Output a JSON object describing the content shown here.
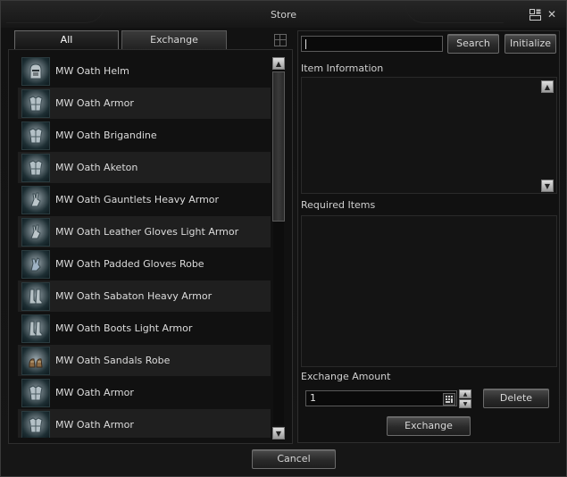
{
  "window": {
    "title": "Store"
  },
  "tabs": [
    {
      "label": "All",
      "active": true
    },
    {
      "label": "Exchange",
      "active": false
    }
  ],
  "items": [
    {
      "name": "MW Oath Helm",
      "icon": "helm-icon"
    },
    {
      "name": "MW Oath Armor",
      "icon": "armor-icon"
    },
    {
      "name": "MW Oath Brigandine",
      "icon": "armor-icon"
    },
    {
      "name": "MW Oath Aketon",
      "icon": "armor-icon"
    },
    {
      "name": "MW Oath Gauntlets Heavy Armor",
      "icon": "gauntlet-icon"
    },
    {
      "name": "MW Oath Leather Gloves Light Armor",
      "icon": "gauntlet-icon"
    },
    {
      "name": "MW Oath Padded Gloves Robe",
      "icon": "glove-icon"
    },
    {
      "name": "MW Oath Sabaton Heavy Armor",
      "icon": "boots-icon"
    },
    {
      "name": "MW Oath Boots Light Armor",
      "icon": "boots-icon"
    },
    {
      "name": "MW Oath Sandals Robe",
      "icon": "sandals-icon"
    },
    {
      "name": "MW Oath Armor",
      "icon": "armor-icon"
    },
    {
      "name": "MW Oath Armor",
      "icon": "armor-icon"
    }
  ],
  "search": {
    "value": "",
    "button": "Search",
    "initialize": "Initialize"
  },
  "item_information": {
    "label": "Item Information"
  },
  "required_items": {
    "label": "Required Items"
  },
  "exchange_amount": {
    "label": "Exchange Amount",
    "value": "1",
    "delete": "Delete",
    "exchange": "Exchange"
  },
  "footer": {
    "cancel": "Cancel"
  }
}
